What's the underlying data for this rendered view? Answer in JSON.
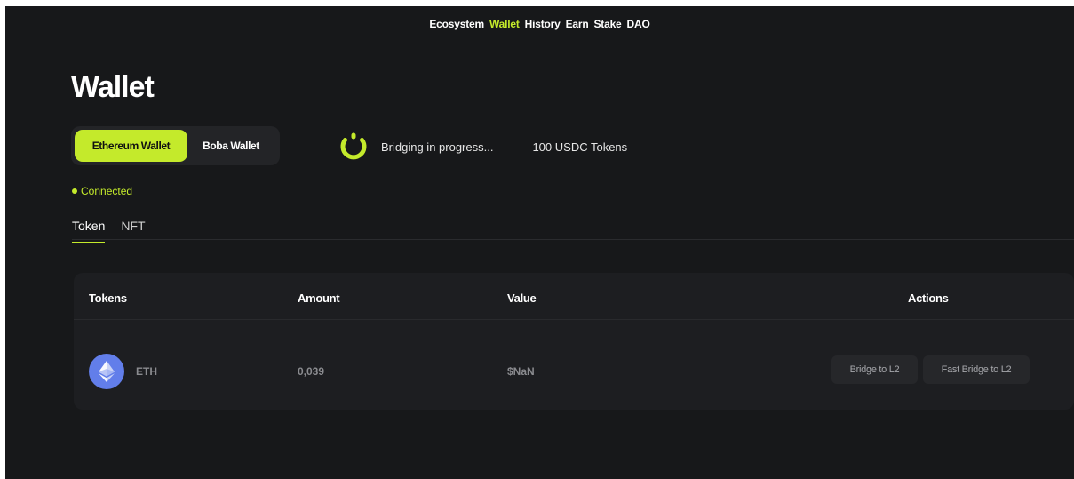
{
  "nav": {
    "items": [
      {
        "label": "Ecosystem",
        "active": false
      },
      {
        "label": "Wallet",
        "active": true
      },
      {
        "label": "History",
        "active": false
      },
      {
        "label": "Earn",
        "active": false
      },
      {
        "label": "Stake",
        "active": false
      },
      {
        "label": "DAO",
        "active": false
      }
    ]
  },
  "page": {
    "title": "Wallet"
  },
  "wallet_switch": {
    "ethereum_label": "Ethereum Wallet",
    "boba_label": "Boba Wallet"
  },
  "bridging": {
    "status": "Bridging in progress...",
    "tokens": "100 USDC Tokens"
  },
  "connection": {
    "status": "Connected"
  },
  "tabs": [
    {
      "label": "Token",
      "active": true
    },
    {
      "label": "NFT",
      "active": false
    }
  ],
  "table": {
    "headers": {
      "tokens": "Tokens",
      "amount": "Amount",
      "value": "Value",
      "actions": "Actions"
    },
    "rows": [
      {
        "icon": "ethereum-icon",
        "token": "ETH",
        "amount": "0,039",
        "value": "$NaN",
        "actions": [
          "Bridge to L2",
          "Fast Bridge to L2"
        ]
      }
    ]
  },
  "colors": {
    "accent": "#c4ea2b",
    "background": "#17181a",
    "panel": "#1d1e21",
    "eth_blue": "#627eea"
  }
}
